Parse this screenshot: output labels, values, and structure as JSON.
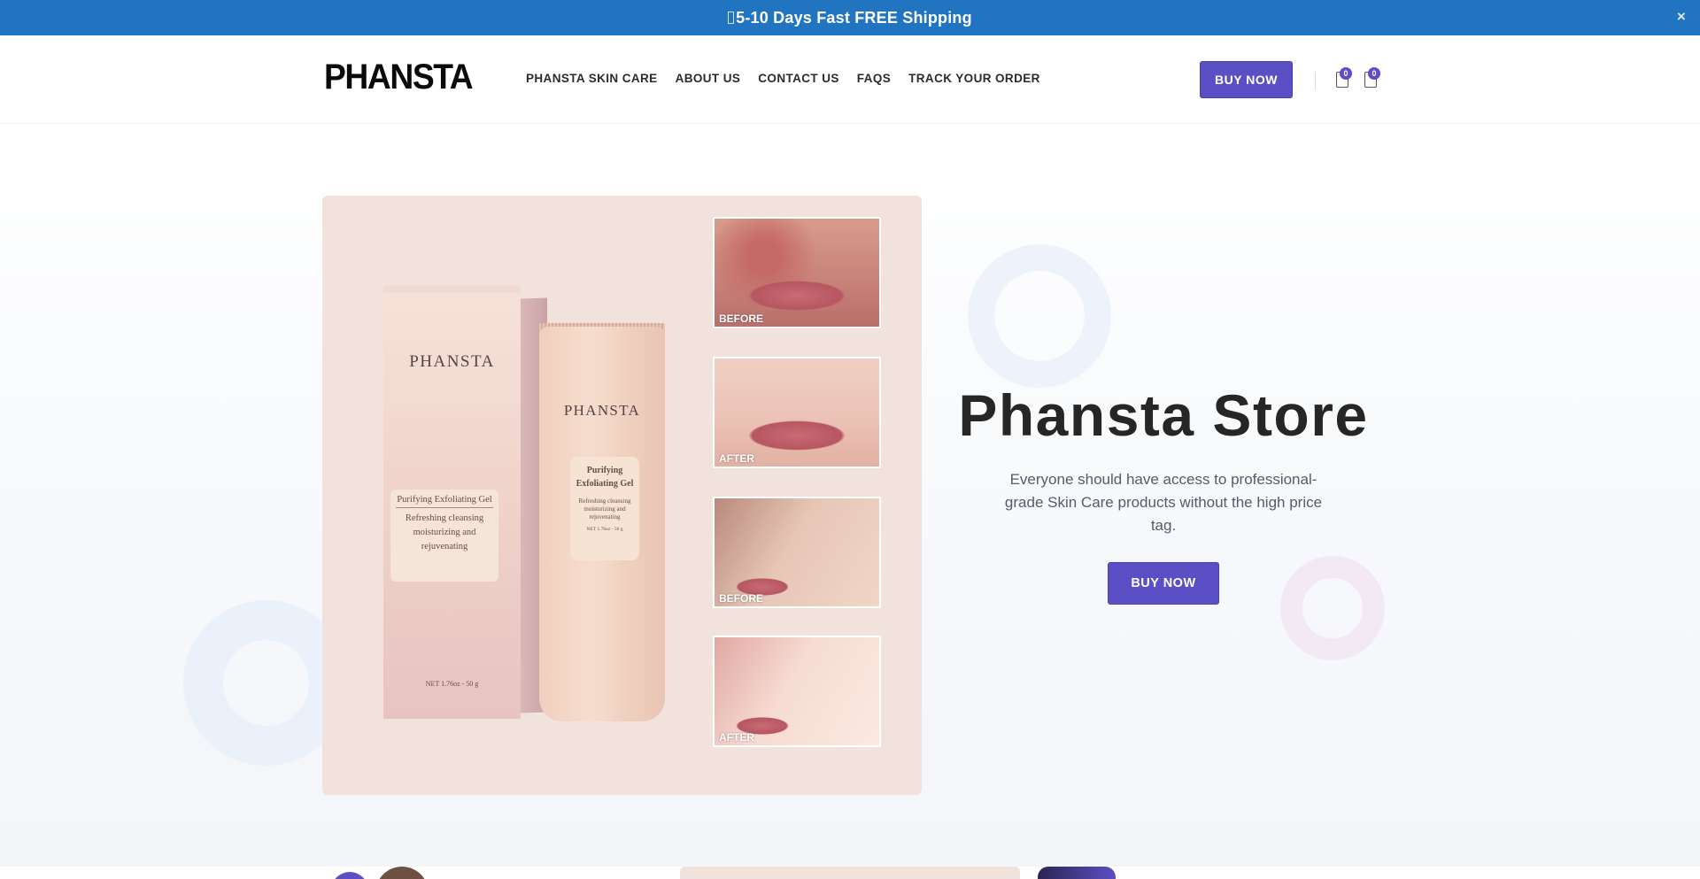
{
  "announcement": {
    "icon": "truck-icon",
    "text": "5-10 Days Fast FREE Shipping",
    "close_label": "×"
  },
  "header": {
    "logo": "PHANSTA",
    "nav": [
      {
        "label": "PHANSTA SKIN CARE"
      },
      {
        "label": "ABOUT US"
      },
      {
        "label": "CONTACT US"
      },
      {
        "label": "FAQS"
      },
      {
        "label": "TRACK YOUR ORDER"
      }
    ],
    "buy_now": "BUY NOW",
    "wishlist_count": "0",
    "cart_count": "0"
  },
  "hero": {
    "product_image": {
      "box_brand": "PHANSTA",
      "box_label_title": "Purifying Exfoliating Gel",
      "box_label_text": "Refreshing cleansing moisturizing and rejuvenating",
      "box_net": "NET 1.76oz - 50 g",
      "tube_brand": "PHANSTA",
      "tube_label_title": "Purifying Exfoliating Gel",
      "tube_label_text": "Refreshing cleansing moisturizing and rejuvenating",
      "tube_net": "NET 1.76oz - 50 g",
      "photos": [
        {
          "tag": "BEFORE"
        },
        {
          "tag": "AFTER"
        },
        {
          "tag": "BEFORE"
        },
        {
          "tag": "AFTER"
        }
      ]
    },
    "title": "Phansta Store",
    "description": "Everyone should have access to professional-grade Skin Care products without the high price tag.",
    "cta": "BUY NOW"
  },
  "colors": {
    "announcement_bg": "#2175c0",
    "accent": "#5b4fc6",
    "product_bg": "#f1e2dc"
  }
}
